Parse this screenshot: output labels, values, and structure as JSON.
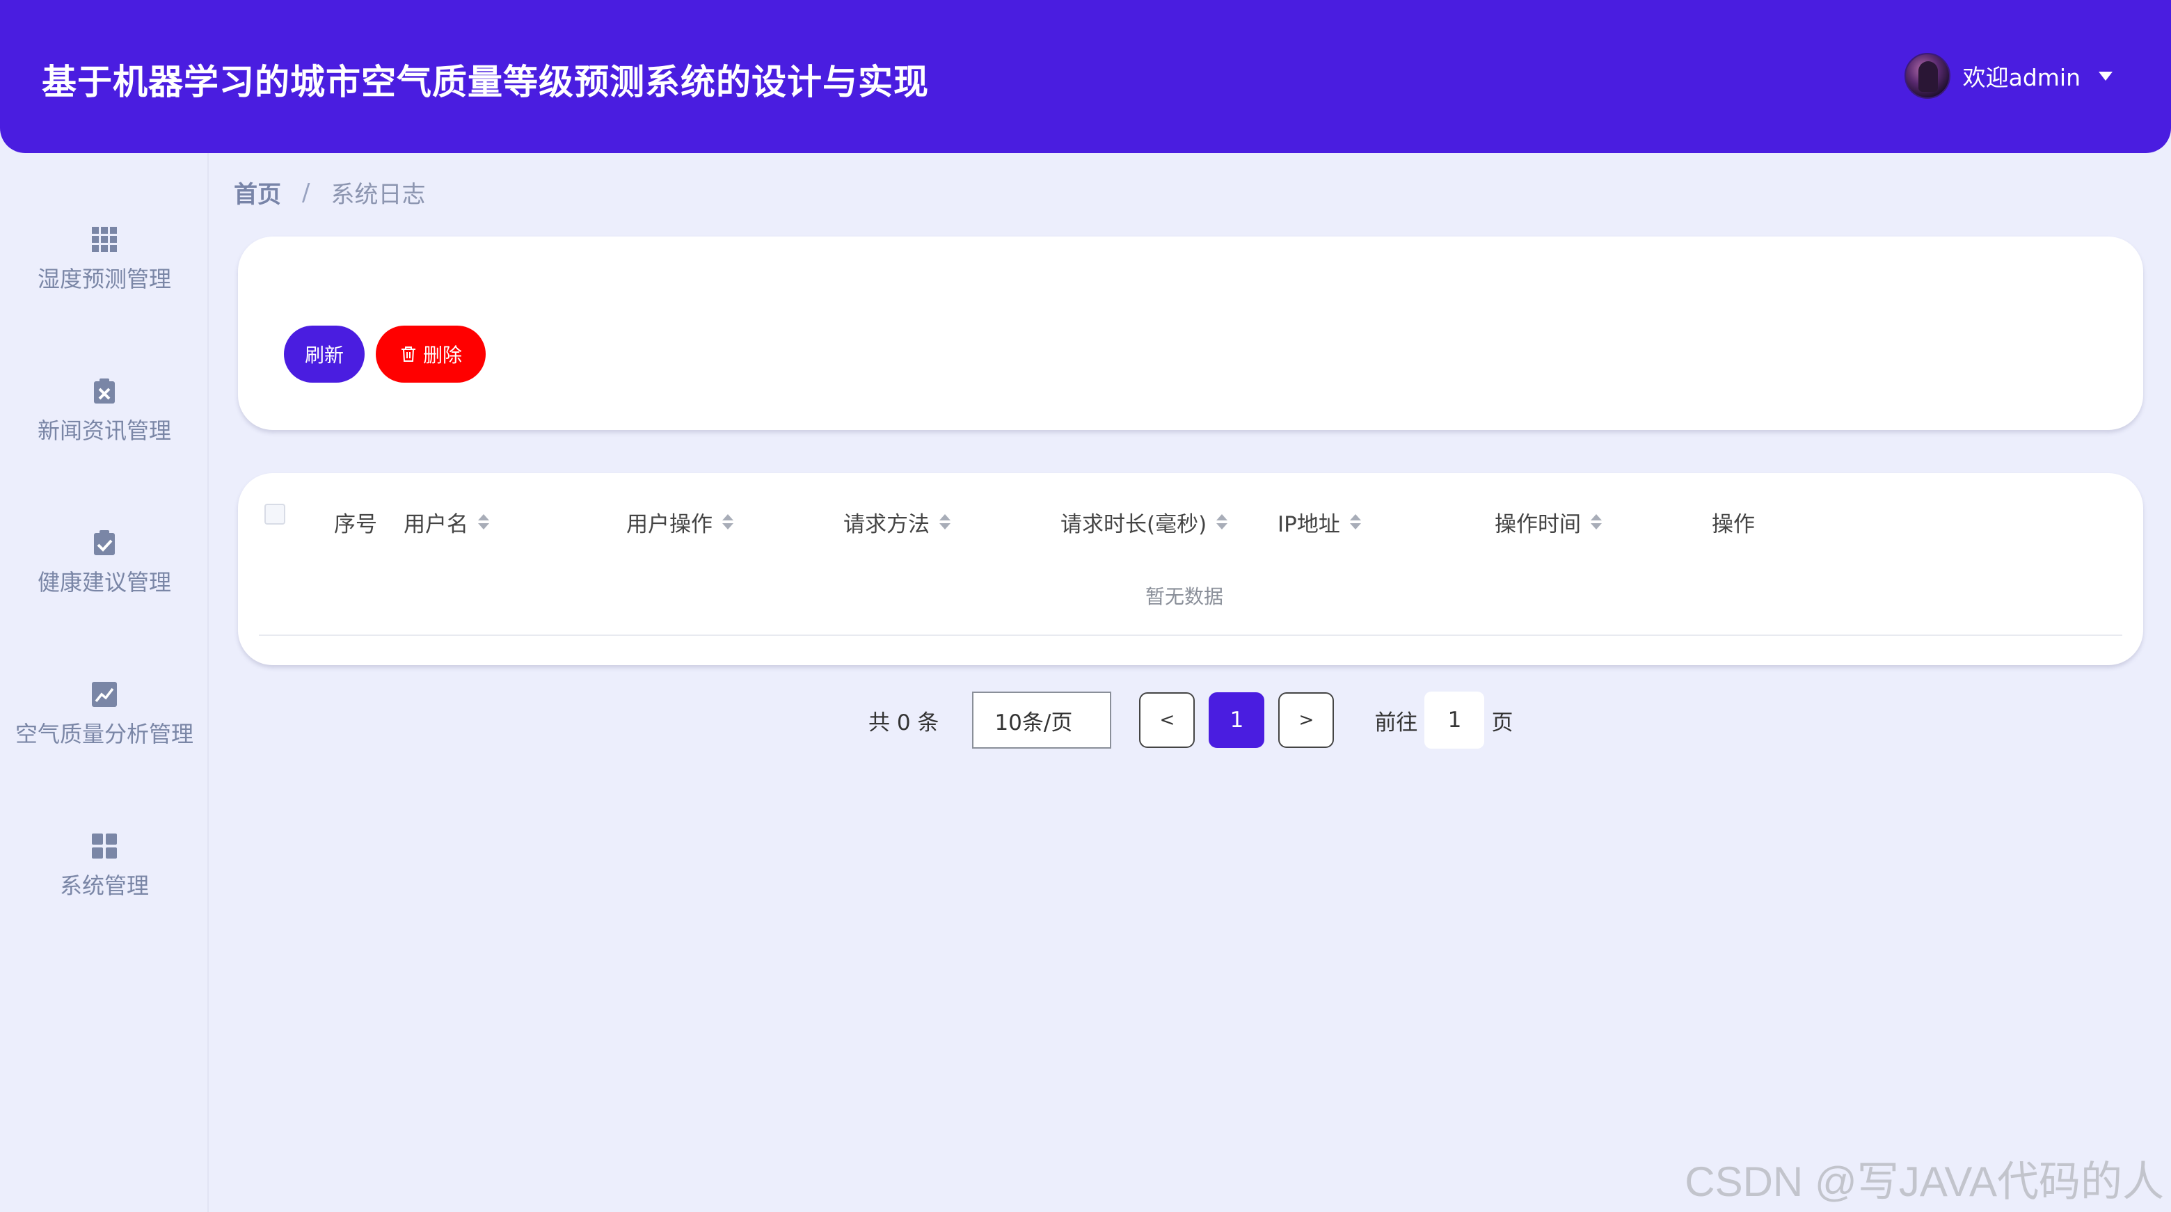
{
  "header": {
    "title": "基于机器学习的城市空气质量等级预测系统的设计与实现",
    "welcome": "欢迎admin",
    "accent_color": "#4a1de0"
  },
  "sidebar": {
    "items": [
      {
        "label": "湿度预测管理",
        "icon": "grid-icon"
      },
      {
        "label": "新闻资讯管理",
        "icon": "clipboard-x-icon"
      },
      {
        "label": "健康建议管理",
        "icon": "clipboard-check-icon"
      },
      {
        "label": "空气质量分析管理",
        "icon": "chart-icon"
      },
      {
        "label": "系统管理",
        "icon": "apps-icon"
      }
    ]
  },
  "breadcrumb": {
    "home": "首页",
    "separator": "/",
    "current": "系统日志"
  },
  "toolbar": {
    "refresh_label": "刷新",
    "delete_label": "删除",
    "delete_color": "#ff0000"
  },
  "table": {
    "columns": [
      "序号",
      "用户名",
      "用户操作",
      "请求方法",
      "请求时长(毫秒)",
      "IP地址",
      "操作时间",
      "操作"
    ],
    "empty_text": "暂无数据"
  },
  "pagination": {
    "total": "共 0 条",
    "page_size": "10条/页",
    "prev": "<",
    "current_page": "1",
    "next": ">",
    "goto_prefix": "前往",
    "goto_value": "1",
    "goto_suffix": "页"
  },
  "watermark": "CSDN @写JAVA代码的人"
}
